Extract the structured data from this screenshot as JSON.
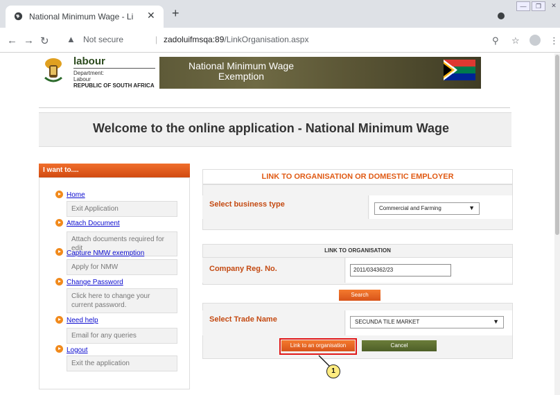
{
  "browser": {
    "tab_title": "National Minimum Wage - Link",
    "tab_close": "✕",
    "new_tab": "+",
    "security_label": "Not secure",
    "separator": "|",
    "url_host": "zadoluifmsqa:89",
    "url_path": "/LinkOrganisation.aspx",
    "window_minimize": "—",
    "window_restore": "❐",
    "window_close": "✕"
  },
  "header": {
    "brand_name": "labour",
    "dept_line1": "Department:",
    "dept_line2": "Labour",
    "country": "REPUBLIC OF SOUTH AFRICA",
    "banner_line1": "National Minimum Wage",
    "banner_line2": "Exemption"
  },
  "welcome": "Welcome to the online application - National Minimum Wage",
  "sidebar": {
    "heading": "I want to....",
    "items": [
      {
        "label": "Home",
        "desc": "Exit Application"
      },
      {
        "label": "Attach Document",
        "desc": "Attach documents required for edit"
      },
      {
        "label": "Capture NMW exemption",
        "desc": "Apply for NMW"
      },
      {
        "label": "Change Password",
        "desc": "Click here to change your current password."
      },
      {
        "label": "Need help",
        "desc": "Email for any queries"
      },
      {
        "label": "Logout",
        "desc": "Exit the application"
      }
    ]
  },
  "form": {
    "section_title": "LINK TO ORGANISATION OR DOMESTIC EMPLOYER",
    "business_type_label": "Select business type",
    "business_type_value": "Commercial and Farming",
    "link_header": "LINK TO ORGANISATION",
    "company_reg_label": "Company Reg. No.",
    "company_reg_value": "2011/034362/23",
    "search_button": "Search",
    "trade_name_label": "Select Trade Name",
    "trade_name_value": "SECUNDA TILE MARKET",
    "link_button": "Link to an organisation",
    "cancel_button": "Cancel"
  },
  "annotation": {
    "step_number": "1",
    "color": "#e01818"
  }
}
